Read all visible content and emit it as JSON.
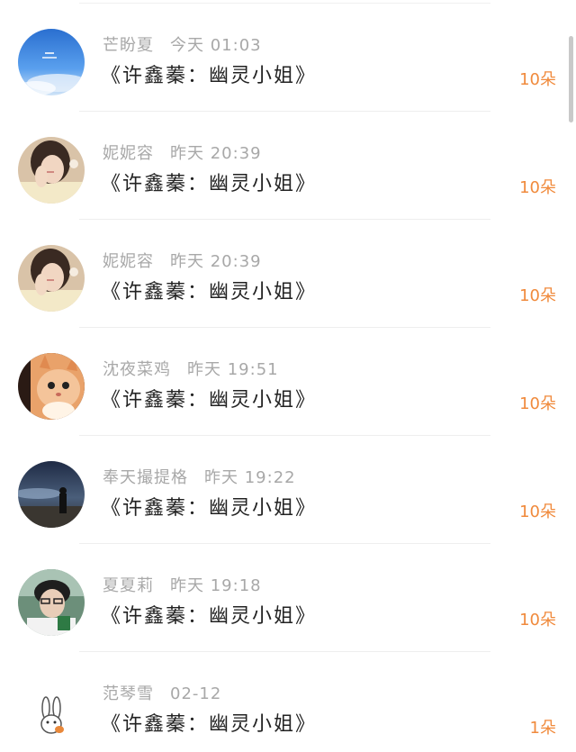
{
  "gifts": [
    {
      "user": "芒盼夏",
      "time": "今天 01:03",
      "title": "《许鑫蓁：幽灵小姐》",
      "amount": "10朵",
      "avatar_icon": "sky-photo-avatar-icon"
    },
    {
      "user": "妮妮容",
      "time": "昨天 20:39",
      "title": "《许鑫蓁：幽灵小姐》",
      "amount": "10朵",
      "avatar_icon": "girl-photo-avatar-icon"
    },
    {
      "user": "妮妮容",
      "time": "昨天 20:39",
      "title": "《许鑫蓁：幽灵小姐》",
      "amount": "10朵",
      "avatar_icon": "girl-photo-avatar-icon"
    },
    {
      "user": "沈夜菜鸡",
      "time": "昨天 19:51",
      "title": "《许鑫蓁：幽灵小姐》",
      "amount": "10朵",
      "avatar_icon": "cat-photo-avatar-icon"
    },
    {
      "user": "奉天撮提格",
      "time": "昨天 19:22",
      "title": "《许鑫蓁：幽灵小姐》",
      "amount": "10朵",
      "avatar_icon": "night-sky-avatar-icon"
    },
    {
      "user": "夏夏莉",
      "time": "昨天 19:18",
      "title": "《许鑫蓁：幽灵小姐》",
      "amount": "10朵",
      "avatar_icon": "boy-photo-avatar-icon"
    },
    {
      "user": "范琴雪",
      "time": "02-12",
      "title": "《许鑫蓁：幽灵小姐》",
      "amount": "1朵",
      "avatar_icon": "bunny-cartoon-avatar-icon"
    }
  ],
  "colors": {
    "amount": "#f08a3c",
    "meta": "#a8a8a8",
    "title": "#222222"
  }
}
